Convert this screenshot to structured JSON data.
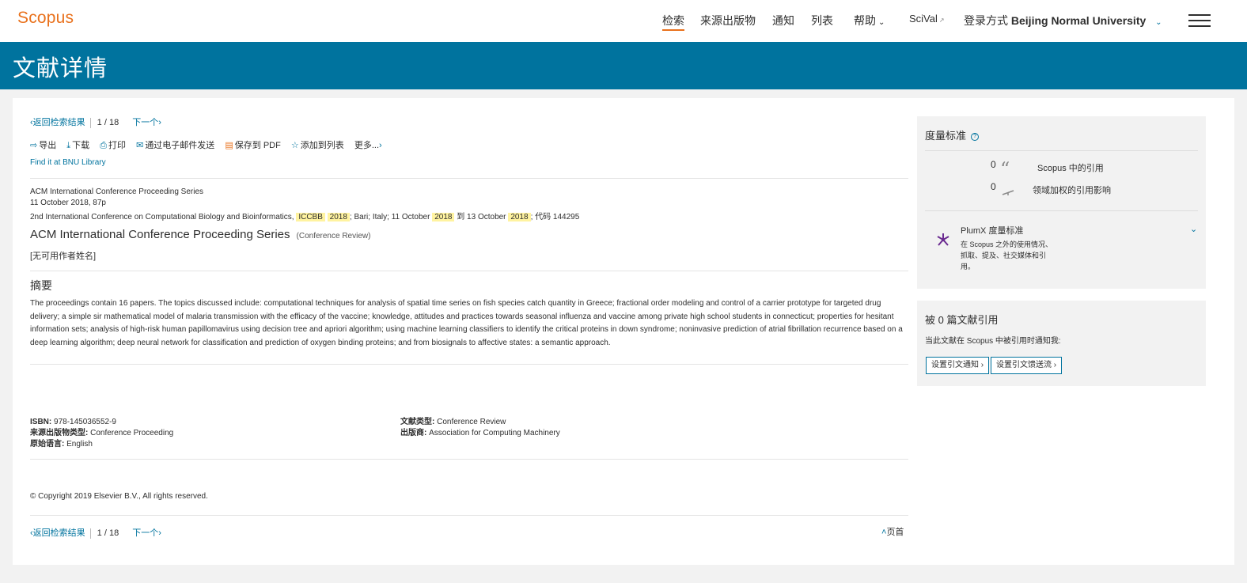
{
  "header": {
    "logo": "Scopus",
    "nav": [
      {
        "label": "检索"
      },
      {
        "label": "来源出版物"
      },
      {
        "label": "通知"
      },
      {
        "label": "列表"
      },
      {
        "label": "帮助"
      },
      {
        "label": "SciVal"
      }
    ],
    "login_prefix": "登录方式",
    "login_institution": "Beijing Normal University"
  },
  "page_title": "文献详情",
  "pager": {
    "back": "返回检索结果",
    "current": "1",
    "separator": "/",
    "total": "18",
    "next": "下一个"
  },
  "toolbar": {
    "export": "导出",
    "download": "下载",
    "print": "打印",
    "email": "通过电子邮件发送",
    "pdf": "保存到 PDF",
    "list": "添加到列表",
    "more": "更多..."
  },
  "find_library": "Find it at BNU Library",
  "source": {
    "series": "ACM International Conference Proceeding Series",
    "date_pages": "11 October 2018, 87p",
    "conf_prefix": "2nd International Conference on Computational Biology and Bioinformatics,",
    "conf_hl1": "ICCBB",
    "conf_hl2": "2018",
    "conf_mid": "; Bari; Italy; 11 October",
    "conf_hl3": "2018",
    "conf_to": "到 13 October",
    "conf_hl4": "2018",
    "conf_code": "; 代码 144295"
  },
  "doc": {
    "title": "ACM International Conference Proceeding Series",
    "type": "(Conference Review)",
    "authors": "[无可用作者姓名]"
  },
  "abstract": {
    "heading": "摘要",
    "text": "The proceedings contain 16 papers. The topics discussed include: computational techniques for analysis of spatial time series on fish species catch quantity in Greece; fractional order modeling and control of a carrier prototype for targeted drug delivery; a simple sir mathematical model of malaria transmission with the efficacy of the vaccine; knowledge, attitudes and practices towards seasonal influenza and vaccine among private high school students in connecticut; properties for hesitant information sets; analysis of high-risk human papillomavirus using decision tree and apriori algorithm; using machine learning classifiers to identify the critical proteins in down syndrome; noninvasive prediction of atrial fibrillation recurrence based on a deep learning algorithm; deep neural network for classification and prediction of oxygen binding proteins; and from biosignals to affective states: a semantic approach."
  },
  "details": {
    "isbn_label": "ISBN:",
    "isbn": "978-145036552-9",
    "source_type_label": "来源出版物类型:",
    "source_type": "Conference Proceeding",
    "language_label": "原始语言:",
    "language": "English",
    "doc_type_label": "文献类型:",
    "doc_type": "Conference Review",
    "publisher_label": "出版商:",
    "publisher": "Association for Computing Machinery"
  },
  "copyright": "© Copyright 2019 Elsevier B.V., All rights reserved.",
  "to_top": "页首",
  "metrics": {
    "title": "度量标准",
    "citations_count": "0",
    "citations_label": "Scopus 中的引用",
    "fwci_count": "0",
    "fwci_label": "领域加权的引用影响",
    "plumx_title": "PlumX 度量标准",
    "plumx_desc": "在 Scopus 之外的使用情况、抓取、提及、社交媒体和引用。"
  },
  "cited_by": {
    "title": "被 0 篇文献引用",
    "desc": "当此文献在 Scopus 中被引用时通知我:",
    "btn_alert": "设置引文通知",
    "btn_feed": "设置引文馈送流"
  },
  "colors": {
    "brand": "#e9711c",
    "band": "#00739e",
    "link": "#00739e"
  }
}
